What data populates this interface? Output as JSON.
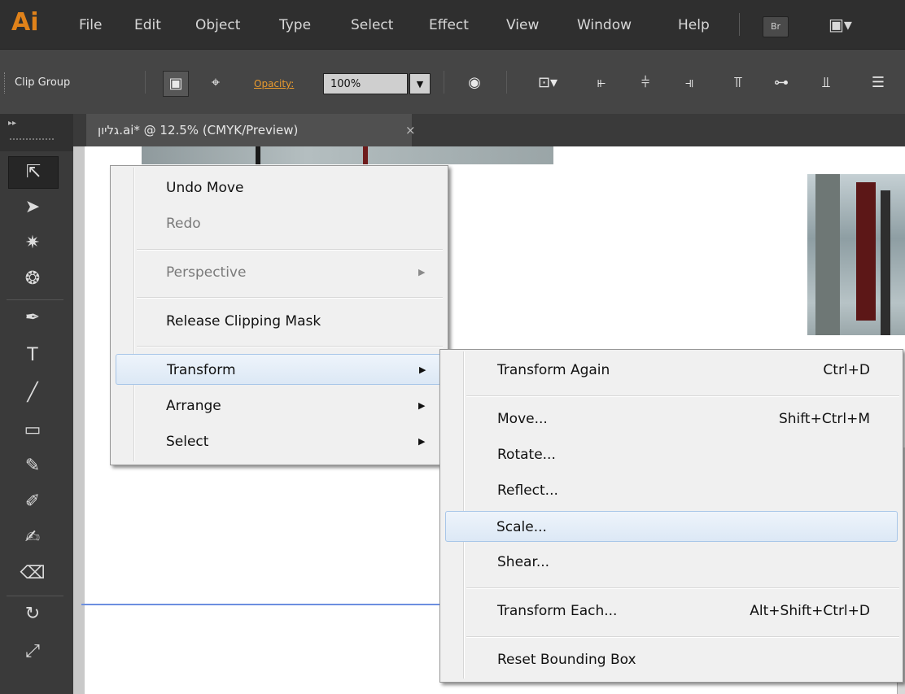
{
  "app": {
    "logo": "Ai"
  },
  "menubar": {
    "items": [
      "File",
      "Edit",
      "Object",
      "Type",
      "Select",
      "Effect",
      "View",
      "Window",
      "Help"
    ],
    "bridge_label": "Br",
    "workspace_icon": "▣▾"
  },
  "controlbar": {
    "selection_label": "Clip Group",
    "opacity_label": "Opacity:",
    "opacity_value": "100%"
  },
  "tools_panel": {
    "collapse_icon": "▸▸"
  },
  "document": {
    "tab_title": "גליון.ai* @ 12.5% (CMYK/Preview)",
    "close": "×"
  },
  "context_menu": {
    "items": [
      {
        "label": "Undo Move",
        "enabled": true
      },
      {
        "label": "Redo",
        "enabled": false
      },
      {
        "label": "Perspective",
        "enabled": false,
        "submenu": true
      },
      {
        "label": "Release Clipping Mask",
        "enabled": true
      },
      {
        "label": "Transform",
        "enabled": true,
        "submenu": true,
        "highlighted": true
      },
      {
        "label": "Arrange",
        "enabled": true,
        "submenu": true
      },
      {
        "label": "Select",
        "enabled": true,
        "submenu": true
      }
    ]
  },
  "transform_submenu": {
    "items": [
      {
        "label": "Transform Again",
        "shortcut": "Ctrl+D"
      },
      {
        "label": "Move...",
        "shortcut": "Shift+Ctrl+M"
      },
      {
        "label": "Rotate...",
        "shortcut": ""
      },
      {
        "label": "Reflect...",
        "shortcut": ""
      },
      {
        "label": "Scale...",
        "shortcut": "",
        "highlighted": true
      },
      {
        "label": "Shear...",
        "shortcut": ""
      },
      {
        "label": "Transform Each...",
        "shortcut": "Alt+Shift+Ctrl+D"
      },
      {
        "label": "Reset Bounding Box",
        "shortcut": ""
      }
    ]
  }
}
